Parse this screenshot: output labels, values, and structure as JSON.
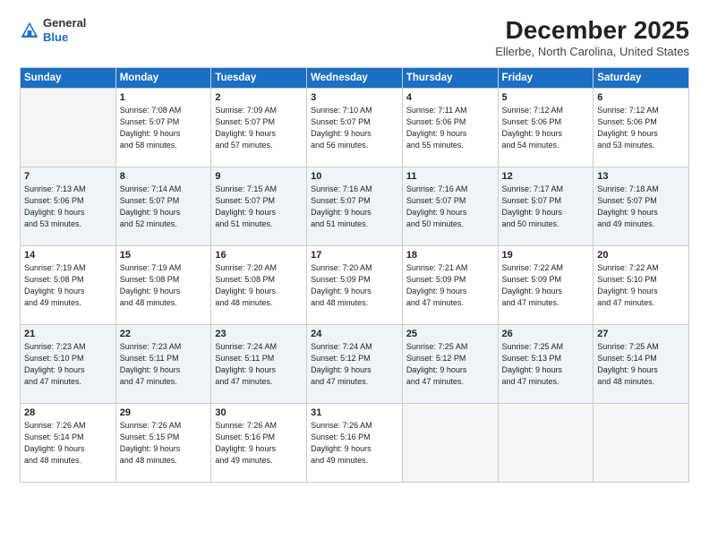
{
  "logo": {
    "line1": "General",
    "line2": "Blue"
  },
  "header": {
    "month": "December 2025",
    "location": "Ellerbe, North Carolina, United States"
  },
  "weekdays": [
    "Sunday",
    "Monday",
    "Tuesday",
    "Wednesday",
    "Thursday",
    "Friday",
    "Saturday"
  ],
  "weeks": [
    [
      {
        "day": "",
        "info": ""
      },
      {
        "day": "1",
        "info": "Sunrise: 7:08 AM\nSunset: 5:07 PM\nDaylight: 9 hours\nand 58 minutes."
      },
      {
        "day": "2",
        "info": "Sunrise: 7:09 AM\nSunset: 5:07 PM\nDaylight: 9 hours\nand 57 minutes."
      },
      {
        "day": "3",
        "info": "Sunrise: 7:10 AM\nSunset: 5:07 PM\nDaylight: 9 hours\nand 56 minutes."
      },
      {
        "day": "4",
        "info": "Sunrise: 7:11 AM\nSunset: 5:06 PM\nDaylight: 9 hours\nand 55 minutes."
      },
      {
        "day": "5",
        "info": "Sunrise: 7:12 AM\nSunset: 5:06 PM\nDaylight: 9 hours\nand 54 minutes."
      },
      {
        "day": "6",
        "info": "Sunrise: 7:12 AM\nSunset: 5:06 PM\nDaylight: 9 hours\nand 53 minutes."
      }
    ],
    [
      {
        "day": "7",
        "info": "Sunrise: 7:13 AM\nSunset: 5:06 PM\nDaylight: 9 hours\nand 53 minutes."
      },
      {
        "day": "8",
        "info": "Sunrise: 7:14 AM\nSunset: 5:07 PM\nDaylight: 9 hours\nand 52 minutes."
      },
      {
        "day": "9",
        "info": "Sunrise: 7:15 AM\nSunset: 5:07 PM\nDaylight: 9 hours\nand 51 minutes."
      },
      {
        "day": "10",
        "info": "Sunrise: 7:16 AM\nSunset: 5:07 PM\nDaylight: 9 hours\nand 51 minutes."
      },
      {
        "day": "11",
        "info": "Sunrise: 7:16 AM\nSunset: 5:07 PM\nDaylight: 9 hours\nand 50 minutes."
      },
      {
        "day": "12",
        "info": "Sunrise: 7:17 AM\nSunset: 5:07 PM\nDaylight: 9 hours\nand 50 minutes."
      },
      {
        "day": "13",
        "info": "Sunrise: 7:18 AM\nSunset: 5:07 PM\nDaylight: 9 hours\nand 49 minutes."
      }
    ],
    [
      {
        "day": "14",
        "info": "Sunrise: 7:19 AM\nSunset: 5:08 PM\nDaylight: 9 hours\nand 49 minutes."
      },
      {
        "day": "15",
        "info": "Sunrise: 7:19 AM\nSunset: 5:08 PM\nDaylight: 9 hours\nand 48 minutes."
      },
      {
        "day": "16",
        "info": "Sunrise: 7:20 AM\nSunset: 5:08 PM\nDaylight: 9 hours\nand 48 minutes."
      },
      {
        "day": "17",
        "info": "Sunrise: 7:20 AM\nSunset: 5:09 PM\nDaylight: 9 hours\nand 48 minutes."
      },
      {
        "day": "18",
        "info": "Sunrise: 7:21 AM\nSunset: 5:09 PM\nDaylight: 9 hours\nand 47 minutes."
      },
      {
        "day": "19",
        "info": "Sunrise: 7:22 AM\nSunset: 5:09 PM\nDaylight: 9 hours\nand 47 minutes."
      },
      {
        "day": "20",
        "info": "Sunrise: 7:22 AM\nSunset: 5:10 PM\nDaylight: 9 hours\nand 47 minutes."
      }
    ],
    [
      {
        "day": "21",
        "info": "Sunrise: 7:23 AM\nSunset: 5:10 PM\nDaylight: 9 hours\nand 47 minutes."
      },
      {
        "day": "22",
        "info": "Sunrise: 7:23 AM\nSunset: 5:11 PM\nDaylight: 9 hours\nand 47 minutes."
      },
      {
        "day": "23",
        "info": "Sunrise: 7:24 AM\nSunset: 5:11 PM\nDaylight: 9 hours\nand 47 minutes."
      },
      {
        "day": "24",
        "info": "Sunrise: 7:24 AM\nSunset: 5:12 PM\nDaylight: 9 hours\nand 47 minutes."
      },
      {
        "day": "25",
        "info": "Sunrise: 7:25 AM\nSunset: 5:12 PM\nDaylight: 9 hours\nand 47 minutes."
      },
      {
        "day": "26",
        "info": "Sunrise: 7:25 AM\nSunset: 5:13 PM\nDaylight: 9 hours\nand 47 minutes."
      },
      {
        "day": "27",
        "info": "Sunrise: 7:25 AM\nSunset: 5:14 PM\nDaylight: 9 hours\nand 48 minutes."
      }
    ],
    [
      {
        "day": "28",
        "info": "Sunrise: 7:26 AM\nSunset: 5:14 PM\nDaylight: 9 hours\nand 48 minutes."
      },
      {
        "day": "29",
        "info": "Sunrise: 7:26 AM\nSunset: 5:15 PM\nDaylight: 9 hours\nand 48 minutes."
      },
      {
        "day": "30",
        "info": "Sunrise: 7:26 AM\nSunset: 5:16 PM\nDaylight: 9 hours\nand 49 minutes."
      },
      {
        "day": "31",
        "info": "Sunrise: 7:26 AM\nSunset: 5:16 PM\nDaylight: 9 hours\nand 49 minutes."
      },
      {
        "day": "",
        "info": ""
      },
      {
        "day": "",
        "info": ""
      },
      {
        "day": "",
        "info": ""
      }
    ]
  ]
}
